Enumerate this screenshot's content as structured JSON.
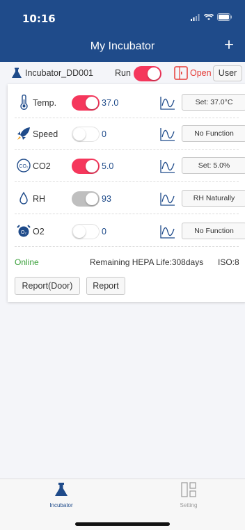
{
  "status": {
    "time": "10:16"
  },
  "nav": {
    "title": "My Incubator",
    "add_label": "+"
  },
  "device": {
    "name": "Incubator_DD001",
    "run_label": "Run",
    "run_on": true,
    "door_label": "Open",
    "user_label": "User"
  },
  "rows": [
    {
      "label": "Temp.",
      "value": "37.0",
      "toggle": "on",
      "button": "Set: 37.0°C",
      "icon": "thermometer-icon"
    },
    {
      "label": "Speed",
      "value": "0",
      "toggle": "off",
      "button": "No Function",
      "icon": "rocket-icon"
    },
    {
      "label": "CO2",
      "value": "5.0",
      "toggle": "on",
      "button": "Set: 5.0%",
      "icon": "co2-icon"
    },
    {
      "label": "RH",
      "value": "93",
      "toggle": "disabled",
      "button": "RH Naturally",
      "icon": "droplet-icon"
    },
    {
      "label": "O2",
      "value": "0",
      "toggle": "off",
      "button": "No Function",
      "icon": "o2-alarm-icon"
    }
  ],
  "footer": {
    "online": "Online",
    "hepa": "Remaining HEPA Life:308days",
    "iso": "ISO:8",
    "report_door": "Report(Door)",
    "report": "Report"
  },
  "tabs": [
    {
      "label": "Incubator",
      "active": true
    },
    {
      "label": "Setting",
      "active": false
    }
  ],
  "colors": {
    "brand": "#1f4b8a",
    "toggle_on": "#f5375c",
    "online": "#3aa03a",
    "door": "#e53935"
  }
}
